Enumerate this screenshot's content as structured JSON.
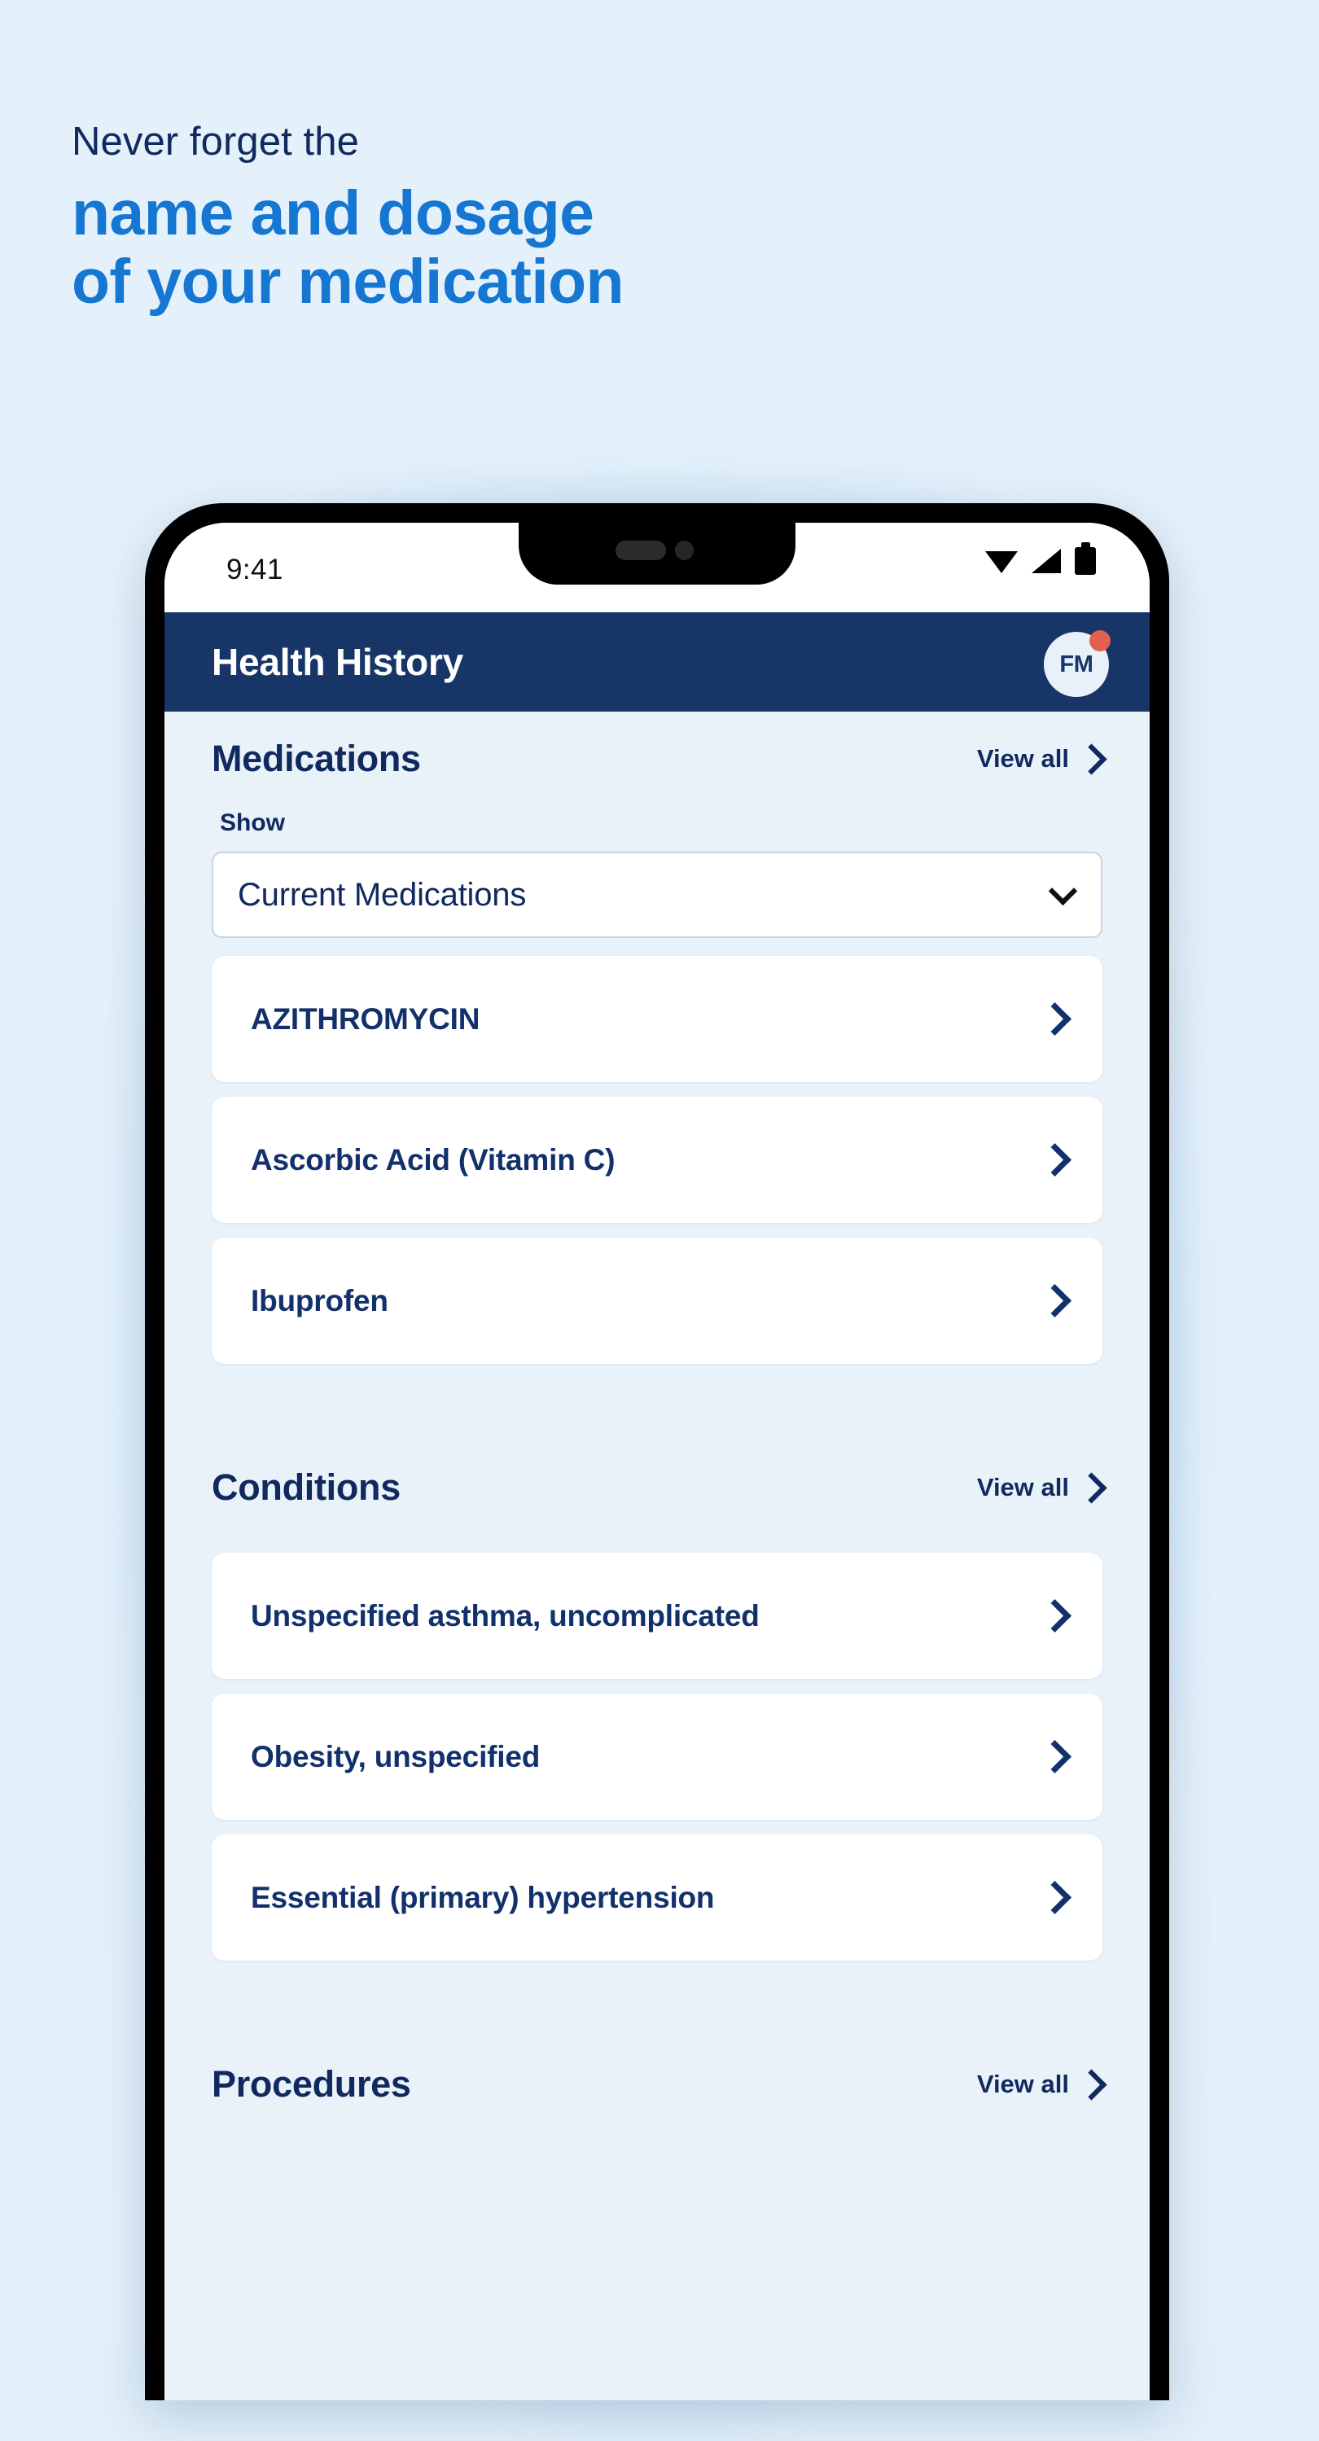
{
  "promo": {
    "kicker": "Never forget the",
    "headline_line1": "name and dosage",
    "headline_line2": "of your medication"
  },
  "colors": {
    "page_bg": "#e3f0fa",
    "headline_accent": "#1577d2",
    "headline_dark": "#10295e",
    "appbar": "#173567",
    "card_bg": "#ffffff",
    "screen_bg": "#e9f1f9",
    "badge_dot": "#e1604f"
  },
  "status_bar": {
    "time": "9:41",
    "icons": [
      "wifi-icon",
      "cellular-signal-icon",
      "battery-icon"
    ]
  },
  "app_bar": {
    "title": "Health History",
    "avatar_initials": "FM",
    "has_notification_dot": true
  },
  "sections": [
    {
      "title": "Medications",
      "view_all_label": "View all",
      "filter": {
        "label": "Show",
        "selected": "Current Medications"
      },
      "items": [
        {
          "label": "AZITHROMYCIN"
        },
        {
          "label": "Ascorbic Acid (Vitamin C)"
        },
        {
          "label": "Ibuprofen"
        }
      ]
    },
    {
      "title": "Conditions",
      "view_all_label": "View all",
      "items": [
        {
          "label": "Unspecified asthma, uncomplicated"
        },
        {
          "label": "Obesity, unspecified"
        },
        {
          "label": "Essential (primary) hypertension"
        }
      ]
    },
    {
      "title": "Procedures",
      "view_all_label": "View all",
      "items": []
    }
  ]
}
